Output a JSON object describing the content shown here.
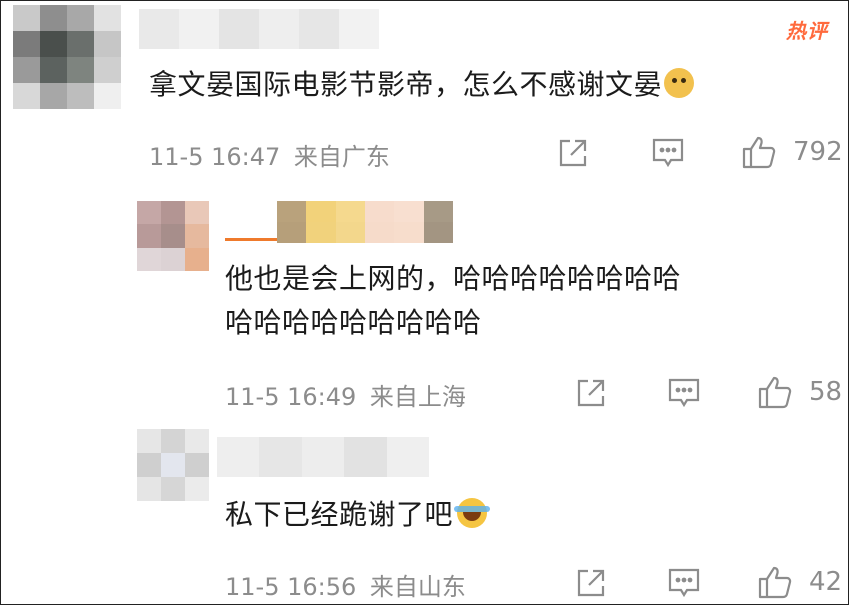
{
  "hot_badge": "热评",
  "main_comment": {
    "text": "拿文晏国际电影节影帝，怎么不感谢文晏",
    "emoji": "doge-emoji",
    "time": "11-5 16:47",
    "location": "来自广东",
    "likes": "792"
  },
  "replies": [
    {
      "text_line1": "他也是会上网的，哈哈哈哈哈哈哈哈",
      "text_line2": "哈哈哈哈哈哈哈哈哈",
      "time": "11-5 16:49",
      "location": "来自上海",
      "likes": "58"
    },
    {
      "text_line1": "私下已经跪谢了吧",
      "emoji": "laugh-cry-emoji",
      "time": "11-5 16:56",
      "location": "来自山东",
      "likes": "42"
    }
  ],
  "icons": {
    "share": "share-icon",
    "comment": "comment-icon",
    "like": "thumbs-up-icon"
  },
  "colors": {
    "text": "#1b1b1b",
    "meta": "#8c8c8c",
    "hot_badge": "#ff6a3d",
    "icon": "#8c8c8c"
  }
}
